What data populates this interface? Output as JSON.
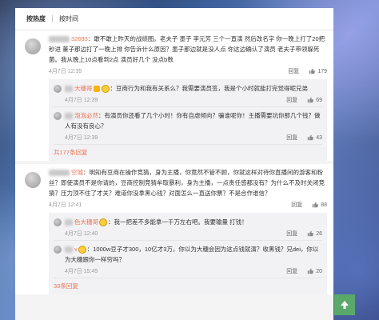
{
  "tabs": [
    {
      "label": "按热度",
      "active": true
    },
    {
      "label": "按时间",
      "active": false
    }
  ],
  "comments": [
    {
      "user": "32693",
      "text": "：敢不敢上昨天的战绩图。老夫子 墨子 李元芳 三个一直演 然后改名字 你一晚上打了20把秒进 董子那边打了一晚上排 你告诉什么原因？墨子那边就是没人点 你这边确认了演员 老夫子带领躲死菌。我从晚上10点看到2点 演员好几个 没点b数",
      "time": "4月7日 12:35",
      "likes": "179",
      "replies": [
        {
          "user": "大穗哥",
          "text": "：豆商行为和我有关系么？我需要演员签，我是个小时就能打完觉得呢兄弟",
          "time": "4月7日 12:39",
          "likes": "69"
        },
        {
          "user": "泡泡必然",
          "text": "：有演员你还看了几个小时！你有自虐倾向？骗谁呢你！主播需要坑你那几个钱？做人有没有良心？",
          "time": "4月7日 12:39",
          "likes": "43"
        }
      ],
      "more": "共177条回复"
    },
    {
      "user": "空城",
      "text": "：明知有豆商在操作竞猜，身为主播，你竟然不管不顾，你就这样对待你直播间的游客和粉丝？即使演员不是你请的，豆商控制竞猜牟取暴利，身为主播，一点责任感都没有？为什么不及时关闭竞猜？压力顶不住了才关？难道你没拿黑心钱？对面怎么一直送你票？不是合作谁信？",
      "time": "4月7日 12:41",
      "likes": "88",
      "replies": [
        {
          "user": "色大穗哥",
          "text": "：我一把差不多能拿一千万左右吧。我要输量 打钱！",
          "time": "4月7日 12:40",
          "likes": "26"
        },
        {
          "user": "v",
          "text": "：1000w豆子才300，10亿才3万，你以为大穗会因为这点钱就演？收黑钱？兄dei，你以为大穗跟你一样穷吗？",
          "time": "4月7日 15:45",
          "likes": "20"
        }
      ],
      "more": "33条回复"
    }
  ],
  "actions": {
    "reply": "回复"
  },
  "icons": {
    "like": "thumbs-up-icon",
    "top": "arrow-up-icon"
  },
  "colors": {
    "username": "#eb7350",
    "scroll_top": "#5aa96a"
  }
}
